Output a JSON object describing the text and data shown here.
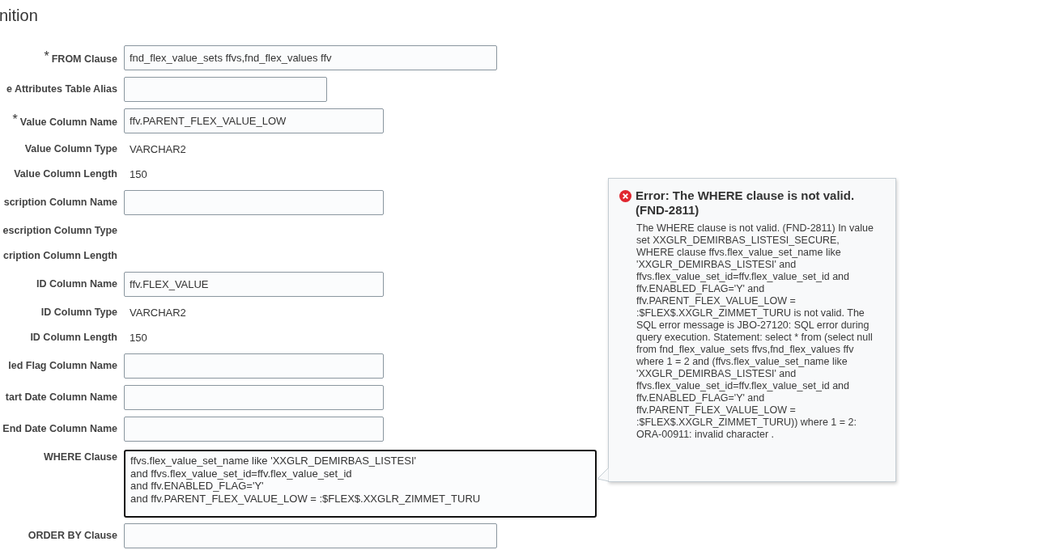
{
  "title": "nition",
  "rows": [
    {
      "label": "FROM Clause",
      "required_mark": "*",
      "kind": "long_field",
      "value": "fnd_flex_value_sets ffvs,fnd_flex_values ffv"
    },
    {
      "label": "e Attributes Table Alias",
      "kind": "short_field"
    },
    {
      "label": "Value Column Name",
      "required_mark": "*",
      "kind": "field",
      "value": "ffv.PARENT_FLEX_VALUE_LOW"
    },
    {
      "label": "Value Column Type",
      "kind": "value",
      "value": "VARCHAR2"
    },
    {
      "label": "Value Column Length",
      "kind": "value",
      "value": "150"
    },
    {
      "label": "scription Column Name",
      "kind": "field"
    },
    {
      "label": "escription Column Type",
      "kind": "value"
    },
    {
      "label": "cription Column Length",
      "kind": "value"
    },
    {
      "label": "ID Column Name",
      "kind": "field",
      "value": "ffv.FLEX_VALUE"
    },
    {
      "label": "ID Column Type",
      "kind": "value",
      "value": "VARCHAR2"
    },
    {
      "label": "ID Column Length",
      "kind": "value",
      "value": "150"
    },
    {
      "label": "led Flag Column Name",
      "kind": "field"
    },
    {
      "label": "tart Date Column Name",
      "kind": "field"
    },
    {
      "label": "End Date Column Name",
      "kind": "field"
    },
    {
      "label": "WHERE Clause",
      "kind": "textarea",
      "value": "ffvs.flex_value_set_name like 'XXGLR_DEMIRBAS_LISTESI'\nand ffvs.flex_value_set_id=ffv.flex_value_set_id\nand ffv.ENABLED_FLAG='Y'\nand ffv.PARENT_FLEX_VALUE_LOW = :$FLEX$.XXGLR_ZIMMET_TURU"
    },
    {
      "label": "ORDER BY Clause",
      "kind": "long_field"
    }
  ],
  "error": {
    "title": "Error: The WHERE clause is not valid. (FND-2811)",
    "message": "The WHERE clause is not valid. (FND-2811) In value set XXGLR_DEMIRBAS_LISTESI_SECURE, WHERE clause ffvs.flex_value_set_name like 'XXGLR_DEMIRBAS_LISTESI' and ffvs.flex_value_set_id=ffv.flex_value_set_id and ffv.ENABLED_FLAG='Y' and ffv.PARENT_FLEX_VALUE_LOW = :$FLEX$.XXGLR_ZIMMET_TURU is not valid. The SQL error message is JBO-27120: SQL error during query execution. Statement: select * from (select null from fnd_flex_value_sets ffvs,fnd_flex_values ffv where 1 = 2 and (ffvs.flex_value_set_name like 'XXGLR_DEMIRBAS_LISTESI' and ffvs.flex_value_set_id=ffv.flex_value_set_id and ffv.ENABLED_FLAG='Y' and ffv.PARENT_FLEX_VALUE_LOW = :$FLEX$.XXGLR_ZIMMET_TURU)) where 1 = 2: ORA-00911: invalid character ."
  }
}
